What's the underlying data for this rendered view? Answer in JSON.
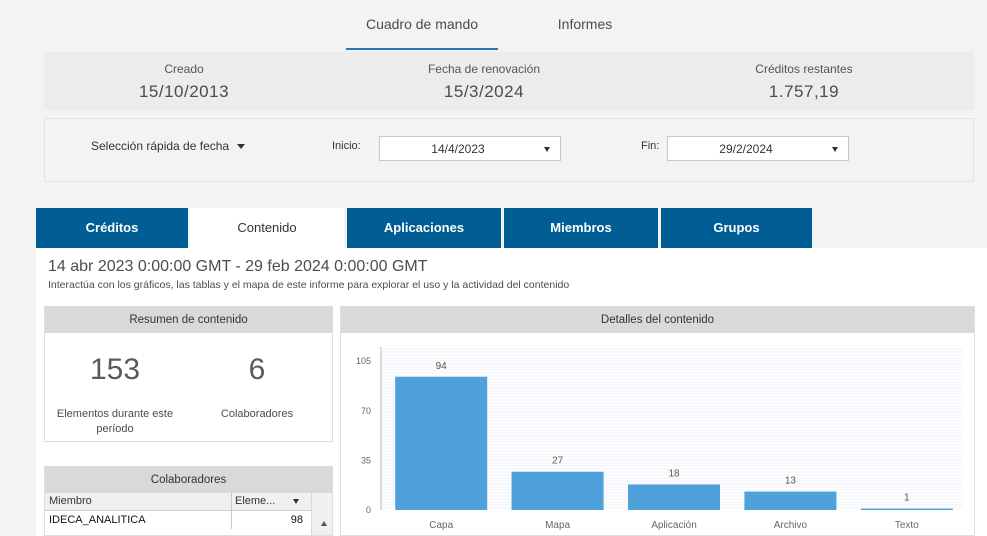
{
  "nav": {
    "tabs": [
      {
        "label": "Cuadro de mando",
        "active": true
      },
      {
        "label": "Informes",
        "active": false
      }
    ]
  },
  "info": {
    "created": {
      "label": "Creado",
      "value": "15/10/2013"
    },
    "renewal": {
      "label": "Fecha de renovación",
      "value": "15/3/2024"
    },
    "credits": {
      "label": "Créditos restantes",
      "value": "1.757,19"
    }
  },
  "dates": {
    "quick_label": "Selección rápida de fecha",
    "start_label": "Inicio:",
    "start_value": "14/4/2023",
    "end_label": "Fin:",
    "end_value": "29/2/2024"
  },
  "report_tabs": [
    {
      "label": "Créditos",
      "active": false
    },
    {
      "label": "Contenido",
      "active": true
    },
    {
      "label": "Aplicaciones",
      "active": false
    },
    {
      "label": "Miembros",
      "active": false
    },
    {
      "label": "Grupos",
      "active": false
    }
  ],
  "content": {
    "range": "14 abr 2023 0:00:00 GMT - 29 feb 2024 0:00:00 GMT",
    "subtitle": "Interactúa con los gráficos, las tablas y el mapa de este informe para explorar el uso y la actividad del contenido"
  },
  "summary": {
    "title": "Resumen de contenido",
    "items_value": "153",
    "items_label_1": "Elementos durante este",
    "items_label_2": "período",
    "collab_value": "6",
    "collab_label": "Colaboradores"
  },
  "collaborators": {
    "title": "Colaboradores",
    "col_member": "Miembro",
    "col_items": "Eleme...",
    "rows": [
      {
        "member": "IDECA_ANALITICA",
        "items": "98"
      }
    ]
  },
  "details": {
    "title": "Detalles del contenido"
  },
  "chart_data": {
    "type": "bar",
    "categories": [
      "Capa",
      "Mapa",
      "Aplicación",
      "Archivo",
      "Texto"
    ],
    "values": [
      94,
      27,
      18,
      13,
      1
    ],
    "yticks": [
      0,
      35,
      70,
      105
    ],
    "ylim": [
      0,
      115
    ],
    "grid": true,
    "bar_color": "#4ea1db"
  },
  "colors": {
    "tab_blue": "#005e95",
    "bar_blue": "#4ea1db",
    "active_underline": "#2e73b8"
  }
}
